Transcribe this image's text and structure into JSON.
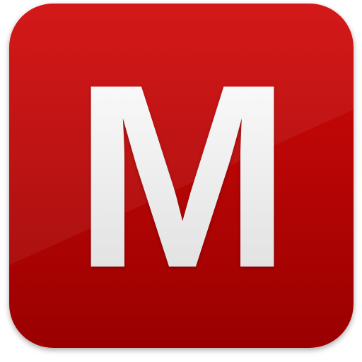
{
  "app_icon": {
    "letter": "M",
    "icon_name": "m-letter-app-icon",
    "colors": {
      "top": "#d20a0a",
      "bottom": "#9a0000",
      "letter_top": "#ffffff",
      "letter_bottom": "#dcdcdc"
    }
  }
}
